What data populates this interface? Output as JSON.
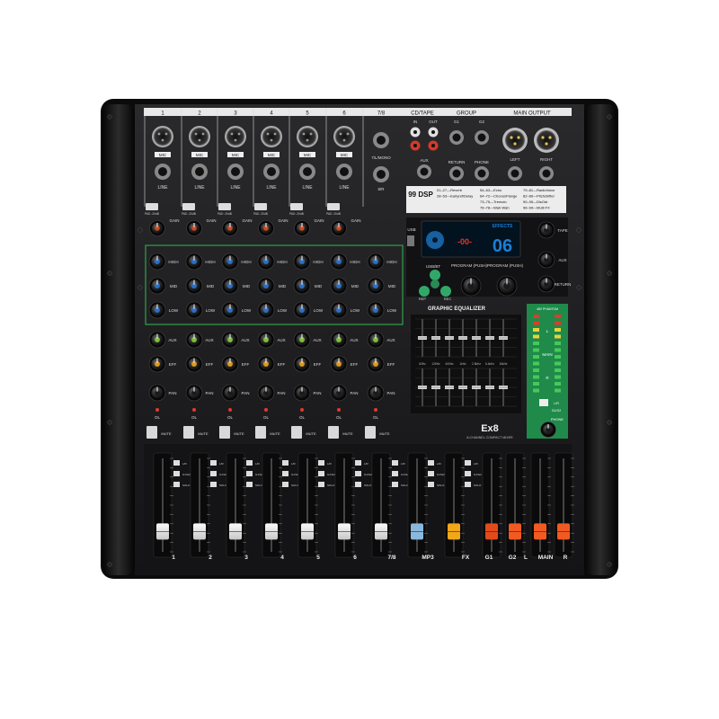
{
  "mixer": {
    "model": "Ex8",
    "model_sub": "8-CHANNEL COMPACT MIXER",
    "dsp_brand": "99 DSP",
    "effect_number": "06",
    "effects_label": "EFFECTS",
    "lcd_readout": "-00-",
    "usb_label": "USB",
    "usb_bt_label": "USB/BT",
    "rep_label": "REP",
    "rec_label": "REC",
    "program_label_left": "PROGRAM (PUSH)",
    "program_label_right": "PROGRAM (PUSH)",
    "geq_title": "GRAPHIC EQUALIZER",
    "geq_freqs": [
      "63Hz",
      "125Hz",
      "400Hz",
      "1kHz",
      "2.5kHz",
      "6.4kHz",
      "16kHz"
    ],
    "fx_list": [
      [
        "01–27—Reverb",
        "54–63—Echo",
        "79–81—RadioVoice"
      ],
      [
        "28–53—Earlyref/Delay",
        "64–72—Chorus/Flange",
        "82–89—Pitchshifter"
      ],
      [
        "",
        "73–75—Tremolo",
        "90–95—DisOdr"
      ],
      [
        "",
        "76–78—Wah-Wah",
        "96–99—Multi FX"
      ]
    ],
    "top_sections": {
      "channel_headers": [
        "1",
        "2",
        "3",
        "4",
        "5",
        "6",
        "7/8"
      ],
      "cd_tape": "CD/TAPE",
      "group": "GROUP",
      "main_output": "MAIN OUTPUT",
      "in_label": "IN",
      "out_label": "OUT",
      "g1_label": "G1",
      "g2_label": "G2",
      "aux_label": "AUX",
      "return_label": "RETURN",
      "phone_label": "PHONE",
      "left_label": "LEFT",
      "right_label": "RIGHT",
      "mic_label": "MIC",
      "line_label": "LINE",
      "lmono_label": "7/L/MONO",
      "r8_label": "8/R"
    },
    "knob_labels": {
      "pad": "PAD -20dB",
      "gain": "GAIN",
      "high": "HIGH",
      "mid": "MID",
      "low": "LOW",
      "aux": "AUX",
      "eff": "EFF",
      "pan": "PAN",
      "ol": "OL",
      "mute": "MUTE",
      "tape": "TAPE",
      "ret": "RETURN"
    },
    "fader_labels": [
      "1",
      "2",
      "3",
      "4",
      "5",
      "6",
      "7/8",
      "MP3",
      "FX",
      "G1",
      "G2",
      "L",
      "MAIN",
      "R"
    ],
    "fader_levels": [
      0.15,
      0.15,
      0.15,
      0.15,
      0.15,
      0.15,
      0.15,
      0.15,
      0.15,
      0.15,
      0.15,
      0.15,
      0.15
    ],
    "route_labels": [
      "L/R",
      "G1/G2",
      "SOLO"
    ],
    "meter_labels": [
      "L",
      "MAIN",
      "R"
    ],
    "phantom_label": "48V  PHANTOM",
    "lr_label": "L/R",
    "g1g2_label": "G1/G2",
    "phone_meter_label": "PHONE",
    "colors": {
      "body": "#1c1c1e",
      "frame": "#0a0a0a",
      "panel_line": "#d8d8d8",
      "eq_green_box": "#2fa24a",
      "lcd_blue": "#1b7fd6",
      "lcd_bg": "#02121f",
      "mic_gain_knob": "#d24a1a",
      "eq_knob_blue": "#2a6fc7",
      "aux_knob_green": "#7bbf3a",
      "eff_knob_orange": "#e09a18",
      "meter_green": "#48c85a",
      "meter_yellow": "#e8d23a",
      "meter_red": "#e23a2a",
      "fader_white": "#e8e8e8",
      "fader_blue": "#8ab8dd",
      "fader_yellow": "#f0a818",
      "fader_red": "#e24a1a",
      "fader_orange_red": "#f25a22"
    }
  }
}
